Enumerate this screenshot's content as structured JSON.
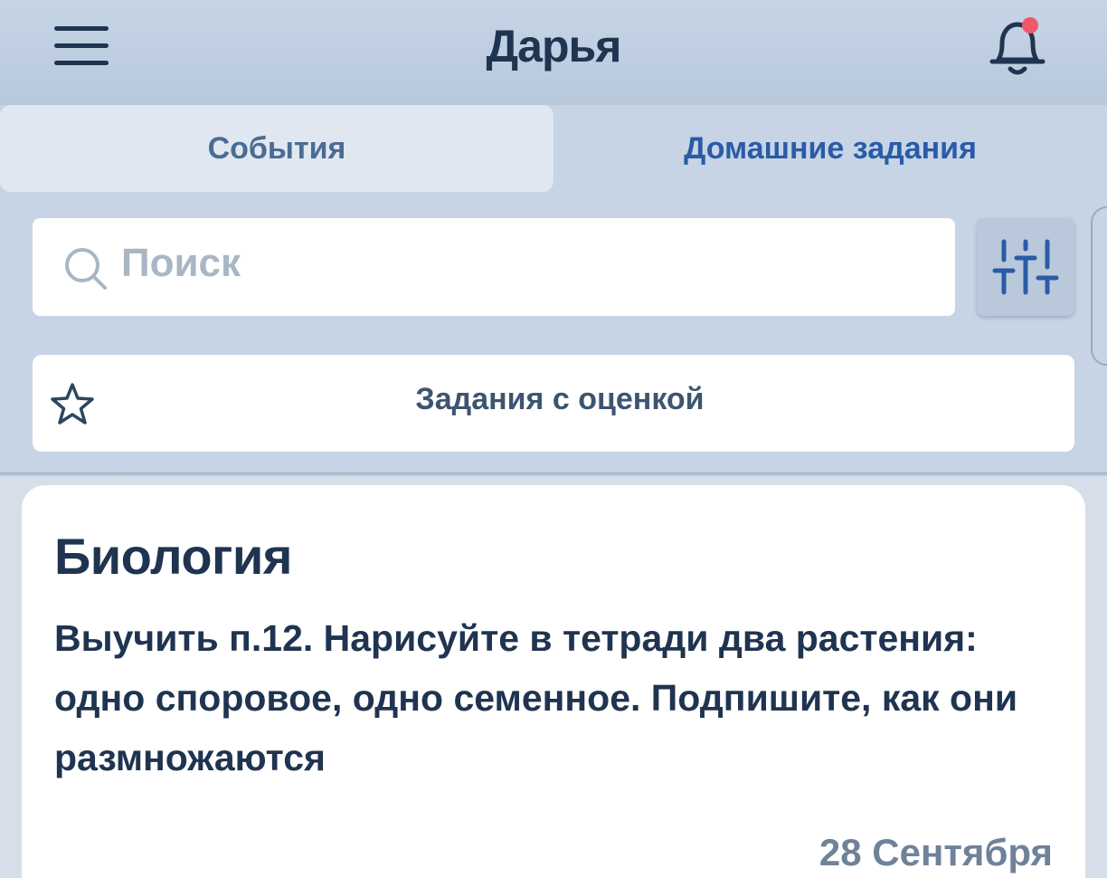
{
  "header": {
    "title": "Дарья",
    "menu_icon": "hamburger-menu-icon",
    "notification_icon": "bell-icon",
    "notification_dot_color": "#f0596b"
  },
  "tabs": [
    {
      "label": "События",
      "active": false
    },
    {
      "label": "Домашние задания",
      "active": true
    }
  ],
  "search": {
    "placeholder": "Поиск",
    "icon": "search-icon"
  },
  "filter": {
    "icon": "sliders-icon"
  },
  "graded_filter": {
    "label": "Задания с оценкой",
    "icon": "star-icon"
  },
  "homework": [
    {
      "subject": "Биология",
      "task": "Выучить п.12. Нарисуйте в тетради два растения: одно споровое, одно семенное. Подпишите, как они размножаются",
      "date": "28 Сентября"
    }
  ],
  "colors": {
    "header_bg": "#c6d5e6",
    "text_dark": "#1f3450",
    "accent_blue": "#2a5ba6"
  }
}
